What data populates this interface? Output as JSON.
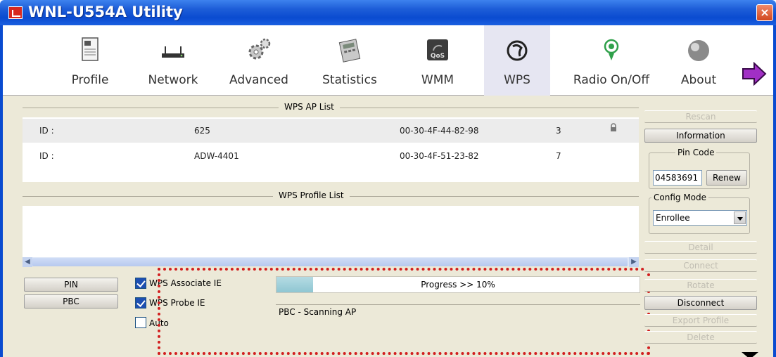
{
  "window": {
    "title": "WNL-U554A Utility",
    "close_label": "×"
  },
  "toolbar": {
    "items": [
      {
        "label": "Profile",
        "icon": "profile-icon"
      },
      {
        "label": "Network",
        "icon": "network-icon"
      },
      {
        "label": "Advanced",
        "icon": "gear-icon"
      },
      {
        "label": "Statistics",
        "icon": "statistics-icon"
      },
      {
        "label": "WMM",
        "icon": "qos-icon",
        "icon_text": "QoS"
      },
      {
        "label": "WPS",
        "icon": "wps-icon",
        "active": true
      },
      {
        "label": "Radio On/Off",
        "icon": "radio-icon"
      },
      {
        "label": "About",
        "icon": "about-icon"
      }
    ]
  },
  "ap_list": {
    "title": "WPS AP List",
    "rows": [
      {
        "id_label": "ID :",
        "ssid": "625",
        "bssid": "00-30-4F-44-82-98",
        "channel": "3",
        "locked": true
      },
      {
        "id_label": "ID :",
        "ssid": "ADW-4401",
        "bssid": "00-30-4F-51-23-82",
        "channel": "7",
        "locked": false
      }
    ]
  },
  "profile_list": {
    "title": "WPS Profile List"
  },
  "buttons": {
    "pin": "PIN",
    "pbc": "PBC"
  },
  "checkboxes": [
    {
      "label": "WPS Associate IE",
      "checked": true
    },
    {
      "label": "WPS Probe IE",
      "checked": true
    },
    {
      "label": "Auto",
      "checked": false
    }
  ],
  "progress": {
    "text": "Progress >> 10%",
    "value": 0.1
  },
  "status": {
    "text": "PBC - Scanning AP"
  },
  "right_panel": {
    "rescan": "Rescan",
    "information": "Information",
    "pin_code_title": "Pin Code",
    "pin_code_value": "04583691",
    "renew": "Renew",
    "config_mode_title": "Config Mode",
    "config_mode_value": "Enrollee",
    "detail": "Detail",
    "connect": "Connect",
    "rotate": "Rotate",
    "disconnect": "Disconnect",
    "export_profile": "Export Profile",
    "delete": "Delete"
  },
  "colors": {
    "titlebar": "#0a4bd0",
    "highlight_border": "#d21f1f",
    "progress_fill": "#8fc6d2"
  }
}
